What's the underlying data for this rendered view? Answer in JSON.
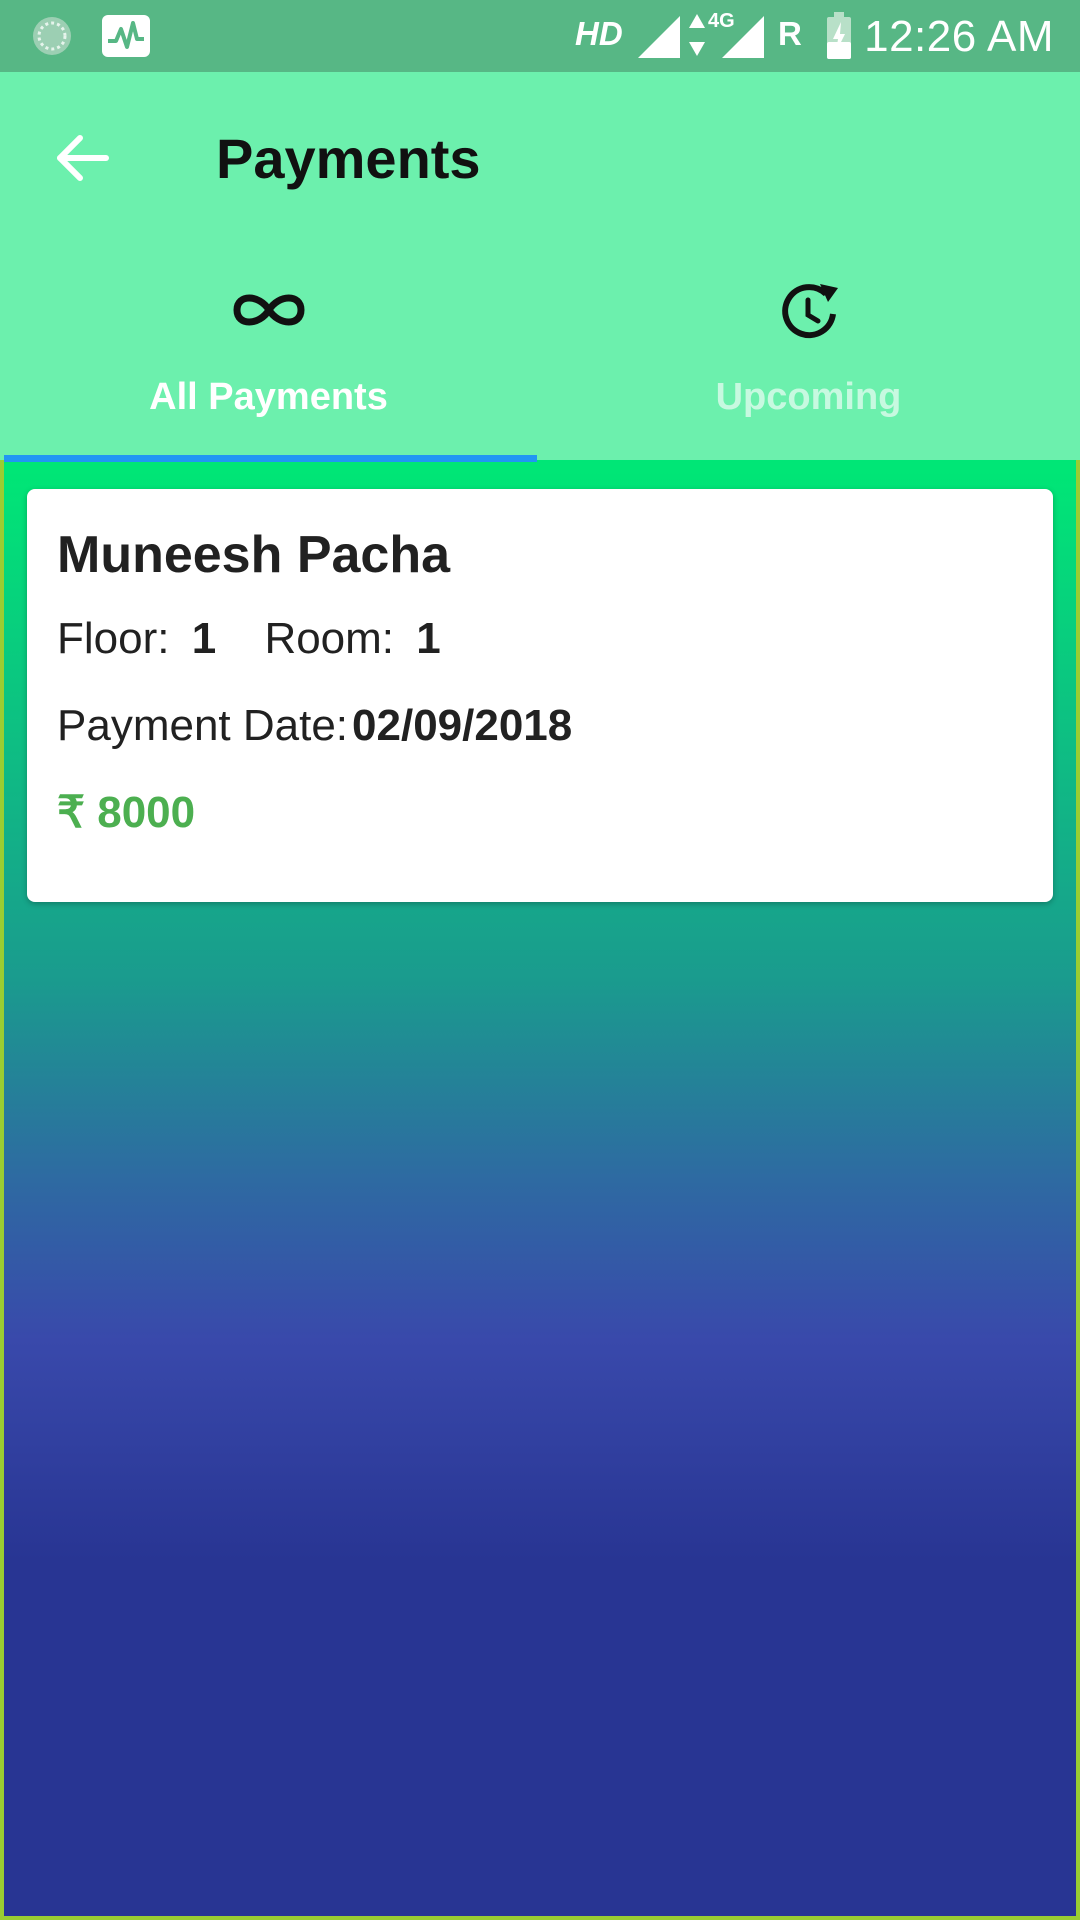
{
  "status_bar": {
    "network_badge": "HD",
    "network_type": "4G",
    "roaming": "R",
    "time": "12:26 AM"
  },
  "app_bar": {
    "title": "Payments"
  },
  "tabs": [
    {
      "label": "All Payments",
      "icon": "infinity-icon",
      "selected": true
    },
    {
      "label": "Upcoming",
      "icon": "clock-refresh-icon",
      "selected": false
    }
  ],
  "payment_card": {
    "name": "Muneesh Pacha",
    "floor_label": "Floor:",
    "floor_value": "1",
    "room_label": "Room:",
    "room_value": "1",
    "date_label": "Payment Date:",
    "date_value": "02/09/2018",
    "currency_symbol": "₹",
    "amount": "8000"
  },
  "colors": {
    "status_bar": "#57b785",
    "app_bar": "#6cf0ad",
    "tab_indicator": "#2196f3",
    "amount_text": "#4caf50"
  }
}
